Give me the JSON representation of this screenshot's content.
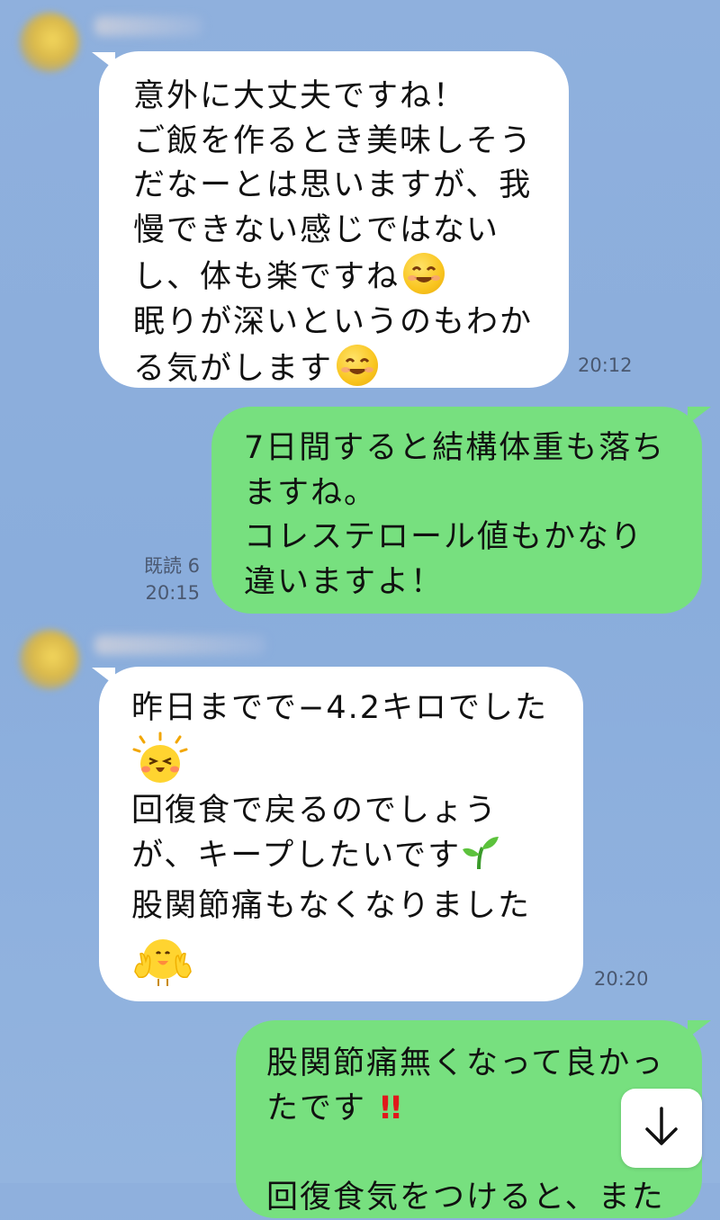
{
  "messages": [
    {
      "direction": "incoming",
      "lines": [
        "意外に大丈夫ですね！",
        "ご飯を作るとき美味しそう",
        "だなーとは思いますが、我",
        "慢できない感じではない",
        "し、体も楽ですね",
        "眠りが深いというのもわか",
        "る気がします"
      ],
      "time": "20:12"
    },
    {
      "direction": "outgoing",
      "lines": [
        "7日間すると結構体重も落ち",
        "ますね。",
        "コレステロール値もかなり",
        "違いますよ！"
      ],
      "read": "既読 6",
      "time": "20:15"
    },
    {
      "direction": "incoming",
      "lines": [
        "昨日までで−4.2キロでした",
        "回復食で戻るのでしょう",
        "が、キープしたいです",
        "股関節痛もなくなりました"
      ],
      "time": "20:20"
    },
    {
      "direction": "outgoing",
      "lines": [
        "股関節痛無くなって良かっ",
        "たです",
        "!!",
        "回復食気をつけると、また"
      ]
    }
  ],
  "icons": {
    "smile": "smiling-face-emoji",
    "chick_happy": "chick-sticker-happy",
    "sprout": "seedling-emoji",
    "chick_peace": "chick-sticker-peace",
    "scroll": "arrow-down-icon"
  },
  "colors": {
    "background": "#8fb0dd",
    "incoming_bubble": "#ffffff",
    "outgoing_bubble": "#77e07f",
    "exclamation": "#e0191b"
  }
}
